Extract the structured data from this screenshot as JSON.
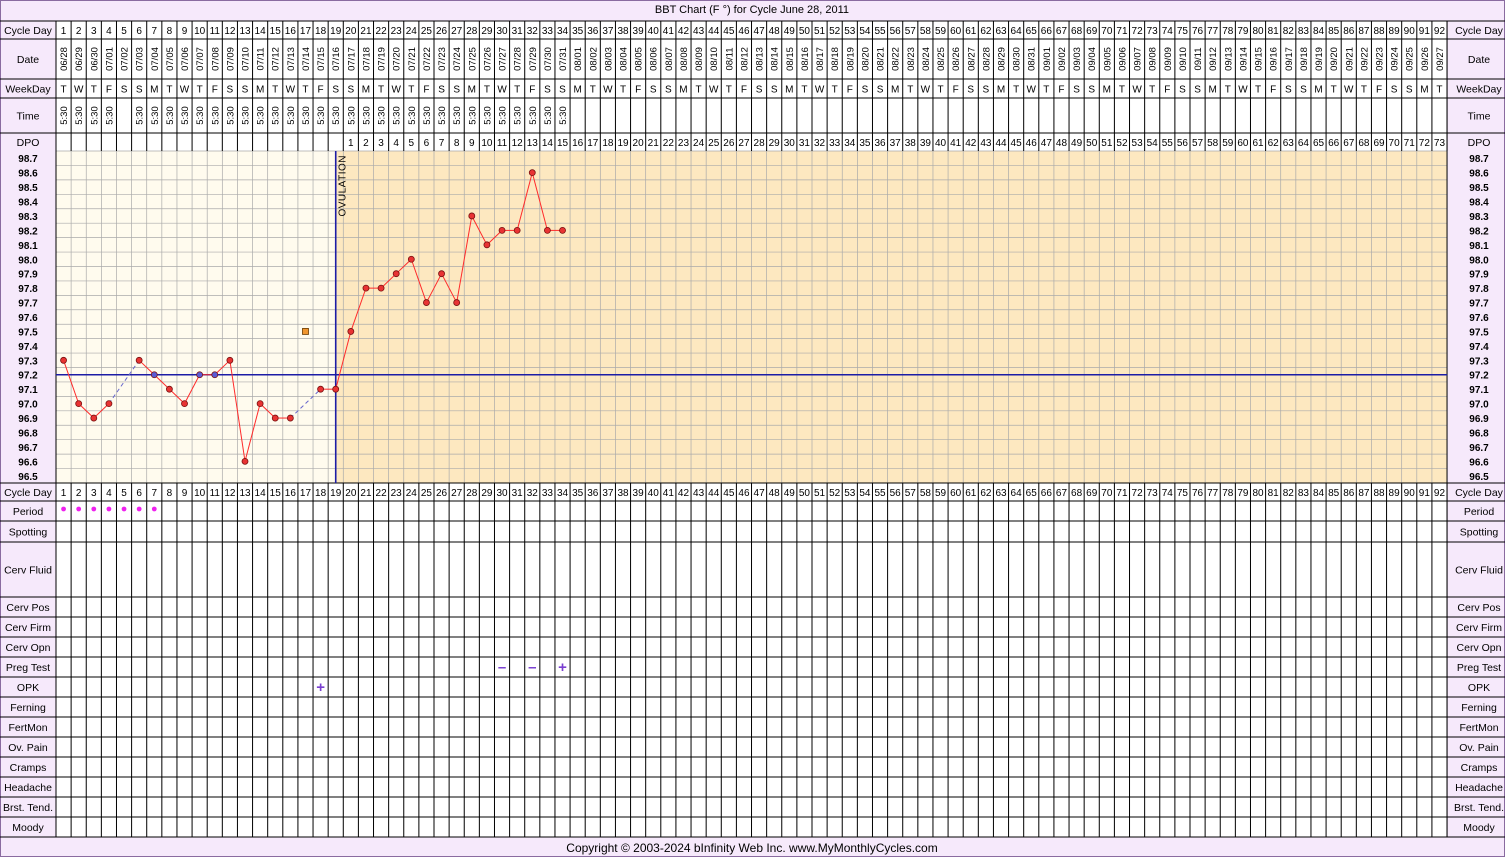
{
  "title": "BBT Chart (F °) for Cycle June 28, 2011",
  "copyright": "Copyright © 2003-2024 bInfinity Web Inc.     www.MyMonthlyCycles.com",
  "row_labels": {
    "cycle_day": "Cycle Day",
    "date": "Date",
    "weekday": "WeekDay",
    "time": "Time",
    "dpo": "DPO",
    "period": "Period",
    "spotting": "Spotting",
    "cerv_fluid": "Cerv Fluid",
    "cerv_pos": "Cerv Pos",
    "cerv_firm": "Cerv Firm",
    "cerv_opn": "Cerv Opn",
    "preg_test": "Preg Test",
    "opk": "OPK",
    "ferning": "Ferning",
    "fertmon": "FertMon",
    "ov_pain": "Ov. Pain",
    "cramps": "Cramps",
    "headache": "Headache",
    "brst_tend": "Brst. Tend.",
    "moody": "Moody"
  },
  "ovulation_label": "OVULATION",
  "colors": {
    "background": "#f6e9fb",
    "pre_ov_fill": "#fffbee",
    "post_ov_fill": "#fde8c0",
    "grid": "#aaaaaa",
    "coverline": "#1c1ca6",
    "temp_line": "#ff2a2a",
    "temp_marker": "#e83333",
    "period_dot": "#ee22ee",
    "test_mark": "#7a3fd0",
    "orange_marker": "#f0962f"
  },
  "chart_data": {
    "type": "line",
    "title": "BBT Chart (F °) for Cycle June 28, 2011",
    "cycle_days": [
      1,
      2,
      3,
      4,
      5,
      6,
      7,
      8,
      9,
      10,
      11,
      12,
      13,
      14,
      15,
      16,
      17,
      18,
      19,
      20,
      21,
      22,
      23,
      24,
      25,
      26,
      27,
      28,
      29,
      30,
      31,
      32,
      33,
      34,
      35,
      36,
      37,
      38,
      39,
      40,
      41,
      42,
      43,
      44,
      45,
      46,
      47,
      48,
      49,
      50,
      51,
      52,
      53,
      54,
      55,
      56,
      57,
      58,
      59,
      60,
      61,
      62,
      63,
      64,
      65,
      66,
      67,
      68,
      69,
      70,
      71,
      72,
      73,
      74,
      75,
      76,
      77,
      78,
      79,
      80,
      81,
      82,
      83,
      84,
      85,
      86,
      87,
      88,
      89,
      90,
      91,
      92
    ],
    "dates": [
      "06/28",
      "06/29",
      "06/30",
      "07/01",
      "07/02",
      "07/03",
      "07/04",
      "07/05",
      "07/06",
      "07/07",
      "07/08",
      "07/09",
      "07/10",
      "07/11",
      "07/12",
      "07/13",
      "07/14",
      "07/15",
      "07/16",
      "07/17",
      "07/18",
      "07/19",
      "07/20",
      "07/21",
      "07/22",
      "07/23",
      "07/24",
      "07/25",
      "07/26",
      "07/27",
      "07/28",
      "07/29",
      "07/30",
      "07/31",
      "08/01",
      "08/02",
      "08/03",
      "08/04",
      "08/05",
      "08/06",
      "08/07",
      "08/08",
      "08/09",
      "08/10",
      "08/11",
      "08/12",
      "08/13",
      "08/14",
      "08/15",
      "08/16",
      "08/17",
      "08/18",
      "08/19",
      "08/20",
      "08/21",
      "08/22",
      "08/23",
      "08/24",
      "08/25",
      "08/26",
      "08/27",
      "08/28",
      "08/29",
      "08/30",
      "08/31",
      "09/01",
      "09/02",
      "09/03",
      "09/04",
      "09/05",
      "09/06",
      "09/07",
      "09/08",
      "09/09",
      "09/10",
      "09/11",
      "09/12",
      "09/13",
      "09/14",
      "09/15",
      "09/16",
      "09/17",
      "09/18",
      "09/19",
      "09/20",
      "09/21",
      "09/22",
      "09/23",
      "09/24",
      "09/25",
      "09/26",
      "09/27"
    ],
    "weekdays": [
      "T",
      "W",
      "T",
      "F",
      "S",
      "S",
      "M",
      "T",
      "W",
      "T",
      "F",
      "S",
      "S",
      "M",
      "T",
      "W",
      "T",
      "F",
      "S",
      "S",
      "M",
      "T",
      "W",
      "T",
      "F",
      "S",
      "S",
      "M",
      "T",
      "W",
      "T",
      "F",
      "S",
      "S",
      "M",
      "T",
      "W",
      "T",
      "F",
      "S",
      "S",
      "M",
      "T",
      "W",
      "T",
      "F",
      "S",
      "S",
      "M",
      "T",
      "W",
      "T",
      "F",
      "S",
      "S",
      "M",
      "T",
      "W",
      "T",
      "F",
      "S",
      "S",
      "M",
      "T",
      "W",
      "T",
      "F",
      "S",
      "S",
      "M",
      "T",
      "W",
      "T",
      "F",
      "S",
      "S",
      "M",
      "T",
      "W",
      "T",
      "F",
      "S",
      "S",
      "M",
      "T",
      "W",
      "T",
      "F",
      "S",
      "S",
      "M",
      "T"
    ],
    "times": [
      "5:30",
      "5:30",
      "5:30",
      "5:30",
      "",
      "5:30",
      "5:30",
      "5:30",
      "5:30",
      "5:30",
      "5:30",
      "5:30",
      "5:30",
      "5:30",
      "5:30",
      "5:30",
      "5:30",
      "5:30",
      "5:30",
      "5:30",
      "5:30",
      "5:30",
      "5:30",
      "5:30",
      "5:30",
      "5:30",
      "5:30",
      "5:30",
      "5:30",
      "5:30",
      "5:30",
      "5:30",
      "5:30",
      "5:30"
    ],
    "dpo": [
      1,
      2,
      3,
      4,
      5,
      6,
      7,
      8,
      9,
      10,
      11,
      12,
      13,
      14,
      15,
      16,
      17,
      18,
      19,
      20,
      21,
      22,
      23,
      24,
      25,
      26,
      27,
      28,
      29,
      30,
      31,
      32,
      33,
      34,
      35,
      36,
      37,
      38,
      39,
      40,
      41,
      42,
      43,
      44,
      45,
      46,
      47,
      48,
      49,
      50,
      51,
      52,
      53,
      54,
      55,
      56,
      57,
      58,
      59,
      60,
      61,
      62,
      63,
      64,
      65,
      66,
      67,
      68,
      69,
      70,
      71,
      72,
      73
    ],
    "dpo_start_day": 20,
    "y_ticks": [
      "98.7",
      "98.6",
      "98.5",
      "98.4",
      "98.3",
      "98.2",
      "98.1",
      "98.0",
      "97.9",
      "97.8",
      "97.7",
      "97.6",
      "97.5",
      "97.4",
      "97.3",
      "97.2",
      "97.1",
      "97.0",
      "96.9",
      "96.8",
      "96.7",
      "96.6",
      "96.5"
    ],
    "ylim": [
      96.5,
      98.7
    ],
    "series": [
      {
        "values": [
          97.3,
          97.0,
          96.9,
          97.0,
          null,
          97.3,
          97.2,
          97.1,
          97.0,
          97.2,
          97.2,
          97.3,
          96.6,
          97.0,
          96.9,
          96.9,
          null,
          97.1,
          97.1,
          97.5,
          97.8,
          97.8,
          97.9,
          98.0,
          97.7,
          97.9,
          97.7,
          98.3,
          98.1,
          98.2,
          98.2,
          98.6,
          98.2,
          98.2
        ]
      }
    ],
    "discarded_point": {
      "day": 17,
      "value": 97.5
    },
    "coverline": 97.2,
    "ovulation_day": 19,
    "period_days": [
      1,
      2,
      3,
      4,
      5,
      6,
      7
    ],
    "preg_tests": [
      {
        "day": 30,
        "mark": "–"
      },
      {
        "day": 32,
        "mark": "–"
      },
      {
        "day": 34,
        "mark": "+"
      }
    ],
    "opk": [
      {
        "day": 18,
        "mark": "+"
      }
    ]
  }
}
